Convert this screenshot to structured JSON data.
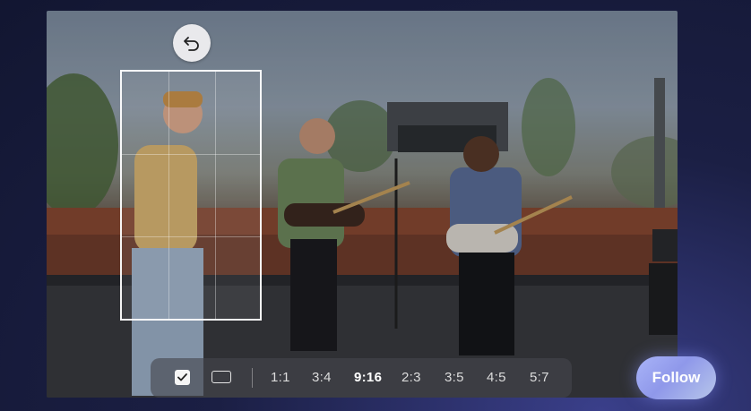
{
  "editor": {
    "undo_icon": "undo-arrow-icon",
    "toolbar": {
      "tools": [
        {
          "name": "check-box-icon",
          "selected": true
        },
        {
          "name": "rectangle-frame-icon",
          "selected": false
        }
      ],
      "ratios": [
        "1:1",
        "3:4",
        "9:16",
        "2:3",
        "3:5",
        "4:5",
        "5:7"
      ],
      "active_ratio": "9:16"
    },
    "follow_label": "Follow"
  },
  "colors": {
    "follow_gradient_start": "#a9b4f8",
    "follow_gradient_end": "#b7c6ea",
    "background": "#1b1f44"
  }
}
